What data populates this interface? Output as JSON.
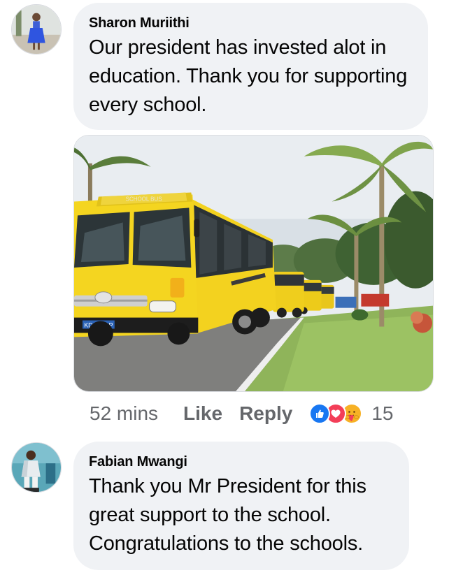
{
  "comments": [
    {
      "author": "Sharon Muriithi",
      "text": "Our president has invested alot in education. Thank you for supporting every school.",
      "attachment": {
        "bus_lettering": "SCHOOL BUS",
        "plate": "KDA 451P"
      },
      "meta": {
        "time": "52 mins",
        "like_label": "Like",
        "reply_label": "Reply",
        "reactions": [
          "like-icon",
          "love-icon",
          "care-icon"
        ],
        "reaction_count": "15"
      }
    },
    {
      "author": "Fabian Mwangi",
      "text": "Thank you Mr President for this great support to the school. Congratulations to the schools."
    }
  ],
  "colors": {
    "bubble": "#f0f2f5",
    "meta_text": "#65676b",
    "like_blue": "#1877f2",
    "love_red": "#f33e58",
    "care_yellow": "#f7b125"
  }
}
